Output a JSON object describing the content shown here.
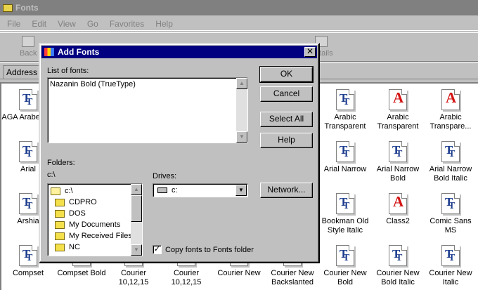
{
  "window": {
    "title": "Fonts",
    "menu": [
      "File",
      "Edit",
      "View",
      "Go",
      "Favorites",
      "Help"
    ],
    "toolbar": {
      "back": "Back",
      "details": "Details"
    },
    "address_label": "Address"
  },
  "fonts": [
    {
      "name": "AGA Arabesq...",
      "type": "tt"
    },
    {
      "name": "Arial",
      "type": "tt"
    },
    {
      "name": "Arshia",
      "type": "tt"
    },
    {
      "name": "Compset",
      "type": "tt"
    },
    {
      "name": "Compset Bold",
      "type": "tt"
    },
    {
      "name": "Courier 10,12,15",
      "type": "tt"
    },
    {
      "name": "Courier 10,12,15",
      "type": "tt"
    },
    {
      "name": "Courier New",
      "type": "tt"
    },
    {
      "name": "Arabic Transparent",
      "type": "tt"
    },
    {
      "name": "Arabic Transparent",
      "type": "a"
    },
    {
      "name": "Arabic Transpare...",
      "type": "a"
    },
    {
      "name": "Arial Narrow",
      "type": "tt"
    },
    {
      "name": "Arial Narrow Bold",
      "type": "tt"
    },
    {
      "name": "Arial Narrow Bold Italic",
      "type": "tt"
    },
    {
      "name": "Bookman Old Style Italic",
      "type": "tt"
    },
    {
      "name": "Class2",
      "type": "a"
    },
    {
      "name": "Comic Sans MS",
      "type": "tt"
    },
    {
      "name": "Courier New Backslanted",
      "type": "tt"
    },
    {
      "name": "Courier New Bold",
      "type": "tt"
    },
    {
      "name": "Courier New Bold Italic",
      "type": "tt"
    },
    {
      "name": "Courier New Italic",
      "type": "tt"
    }
  ],
  "dialog": {
    "title": "Add Fonts",
    "list_label": "List of fonts:",
    "list_items": [
      "Nazanin Bold (TrueType)"
    ],
    "folders_label": "Folders:",
    "current_path": "c:\\",
    "folders": [
      "c:\\",
      "CDPRO",
      "DOS",
      "My Documents",
      "My Received Files",
      "NC"
    ],
    "drives_label": "Drives:",
    "drive_value": "c:",
    "buttons": {
      "ok": "OK",
      "cancel": "Cancel",
      "select_all": "Select All",
      "help": "Help",
      "network": "Network..."
    },
    "copy_label": "Copy fonts to Fonts folder",
    "copy_checked": "✓"
  }
}
